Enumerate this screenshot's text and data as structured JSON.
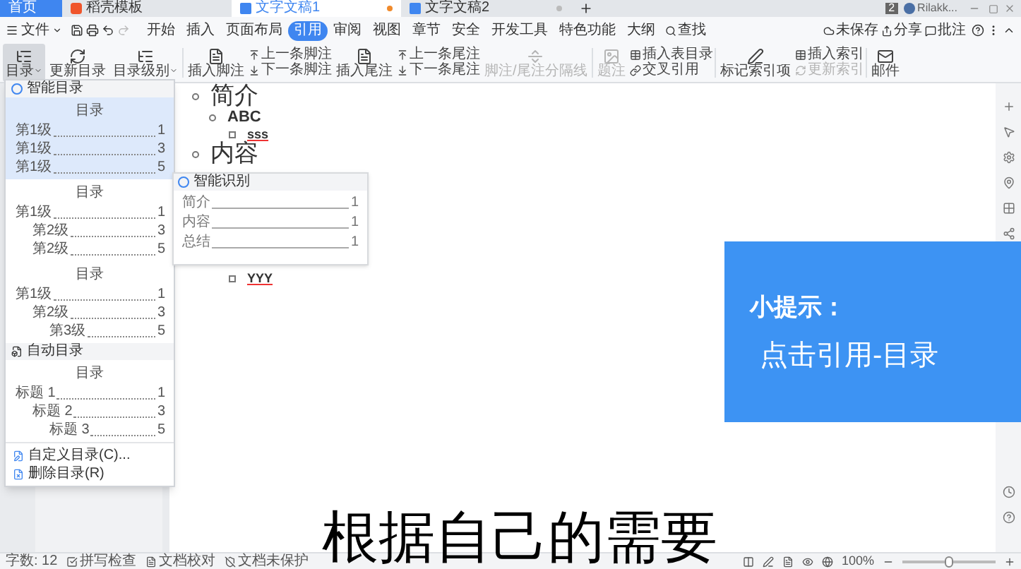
{
  "tabs": [
    {
      "label": "首页",
      "kind": "home",
      "selected": false
    },
    {
      "label": "稻壳模板",
      "kind": "template",
      "selected": false
    },
    {
      "label": "文字文稿1",
      "kind": "doc",
      "selected": true,
      "unsaved": true
    },
    {
      "label": "文字文稿2",
      "kind": "doc",
      "selected": false,
      "unsaved": false
    }
  ],
  "title_bar": {
    "badge": "2",
    "user": "Rilakk..."
  },
  "menu": {
    "file": "文件",
    "ribbon_tabs": [
      {
        "label": "开始",
        "selected": false
      },
      {
        "label": "插入",
        "selected": false
      },
      {
        "label": "页面布局",
        "selected": false
      },
      {
        "label": "引用",
        "selected": true
      },
      {
        "label": "审阅",
        "selected": false
      },
      {
        "label": "视图",
        "selected": false
      },
      {
        "label": "章节",
        "selected": false
      },
      {
        "label": "安全",
        "selected": false
      },
      {
        "label": "开发工具",
        "selected": false
      },
      {
        "label": "特色功能",
        "selected": false
      },
      {
        "label": "大纲",
        "selected": false
      }
    ],
    "search": "查找",
    "right": [
      "未保存",
      "分享",
      "批注"
    ]
  },
  "ribbon": [
    {
      "kind": "large",
      "label": "目录",
      "caret": true,
      "pressed": true,
      "disabled": false
    },
    {
      "kind": "large",
      "label": "更新目录",
      "caret": false,
      "pressed": false,
      "disabled": false
    },
    {
      "kind": "large",
      "label": "目录级别",
      "caret": true,
      "pressed": false,
      "disabled": false
    },
    {
      "kind": "divider"
    },
    {
      "kind": "large",
      "label": "插入脚注",
      "caret": false,
      "pressed": false,
      "disabled": false
    },
    {
      "kind": "stack",
      "items": [
        {
          "label": "上一条脚注",
          "disabled": false
        },
        {
          "label": "下一条脚注",
          "disabled": false
        }
      ]
    },
    {
      "kind": "large",
      "label": "插入尾注",
      "caret": false,
      "pressed": false,
      "disabled": false
    },
    {
      "kind": "stack",
      "items": [
        {
          "label": "上一条尾注",
          "disabled": false
        },
        {
          "label": "下一条尾注",
          "disabled": false
        }
      ]
    },
    {
      "kind": "large",
      "label": "脚注/尾注分隔线",
      "caret": false,
      "pressed": false,
      "disabled": true
    },
    {
      "kind": "divider"
    },
    {
      "kind": "large",
      "label": "题注",
      "caret": false,
      "pressed": false,
      "disabled": true
    },
    {
      "kind": "stack",
      "items": [
        {
          "label": "插入表目录",
          "disabled": false
        },
        {
          "label": "交叉引用",
          "disabled": false
        }
      ]
    },
    {
      "kind": "divider"
    },
    {
      "kind": "large",
      "label": "标记索引项",
      "caret": false,
      "pressed": false,
      "disabled": false
    },
    {
      "kind": "stack",
      "items": [
        {
          "label": "插入索引",
          "disabled": false
        },
        {
          "label": "更新索引",
          "disabled": true
        }
      ]
    },
    {
      "kind": "divider"
    },
    {
      "kind": "large",
      "label": "邮件",
      "caret": false,
      "pressed": false,
      "disabled": false
    }
  ],
  "toc_menu": {
    "sections": [
      {
        "header": "智能目录",
        "kind": "smart",
        "previews": [
          {
            "title": "目录",
            "selected": true,
            "entries": [
              {
                "text": "第1级",
                "page": "1"
              },
              {
                "text": "第1级",
                "page": "3"
              },
              {
                "text": "第1级",
                "page": "5"
              }
            ]
          },
          {
            "title": "目录",
            "selected": false,
            "entries": [
              {
                "text": "第1级",
                "page": "1",
                "children": [
                  {
                    "text": "第2级",
                    "page": "3"
                  },
                  {
                    "text": "第2级",
                    "page": "5"
                  }
                ]
              }
            ]
          },
          {
            "title": "目录",
            "selected": false,
            "entries": [
              {
                "text": "第1级",
                "page": "1",
                "children": [
                  {
                    "text": "第2级",
                    "page": "3",
                    "children": [
                      {
                        "text": "第3级",
                        "page": "5"
                      }
                    ]
                  }
                ]
              }
            ]
          }
        ]
      },
      {
        "header": "自动目录",
        "kind": "auto",
        "previews": [
          {
            "title": "目录",
            "selected": false,
            "entries": [
              {
                "text": "标题 1",
                "page": "1",
                "children": [
                  {
                    "text": "标题 2",
                    "page": "3",
                    "children": [
                      {
                        "text": "标题 3",
                        "page": "5"
                      }
                    ]
                  }
                ]
              }
            ]
          }
        ]
      }
    ],
    "actions": [
      {
        "label": "自定义目录(C)...",
        "kind": "custom"
      },
      {
        "label": "删除目录(R)",
        "kind": "delete"
      }
    ]
  },
  "smart_recognition": {
    "header": "智能识别",
    "entries": [
      {
        "text": "简介",
        "page": "1"
      },
      {
        "text": "内容",
        "page": "1"
      },
      {
        "text": "总结",
        "page": "1"
      }
    ]
  },
  "document": {
    "outline": [
      {
        "text": "简介",
        "children": [
          {
            "text": "ABC",
            "children": [
              {
                "text": "sss"
              }
            ]
          }
        ]
      },
      {
        "text": "内容"
      }
    ],
    "partial": "YYY"
  },
  "tip": {
    "title": "小提示：",
    "text": "点击引用-目录"
  },
  "caption": "根据自己的需要",
  "status_bar": {
    "items": [
      {
        "label": "字数: 12",
        "kind": "text"
      },
      {
        "label": "拼写检查",
        "kind": "spell"
      },
      {
        "label": "文档校对",
        "kind": "proof"
      },
      {
        "label": "文档未保护",
        "kind": "protect"
      }
    ],
    "zoom": {
      "reading": "100%",
      "level": 0.5
    }
  }
}
